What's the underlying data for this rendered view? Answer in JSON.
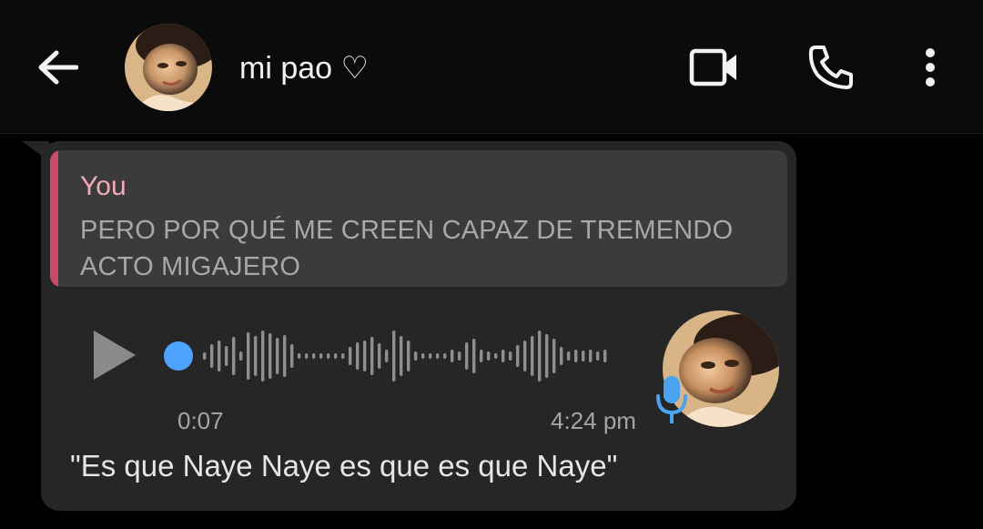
{
  "header": {
    "contact_name": "mi pao ♡",
    "back_icon": "arrow-left-icon",
    "video_icon": "video-camera-icon",
    "call_icon": "phone-icon",
    "menu_icon": "more-vertical-icon"
  },
  "message": {
    "quote": {
      "author": "You",
      "text": "PERO POR QUÉ ME CREEN CAPAZ DE TREMENDO ACTO MIGAJERO"
    },
    "voice_note": {
      "duration": "0:07",
      "sent_time": "4:24 pm",
      "progress": 0,
      "transcript": "\"Es que Naye Naye es que es que Naye\""
    }
  },
  "colors": {
    "header_bg": "#0b0b0b",
    "bubble_bg": "#262626",
    "quote_bg": "#3b3b3b",
    "quote_accent": "#c94a6a",
    "quote_author": "#f4a9b8",
    "progress_dot": "#4da3ff",
    "mic": "#4aa3f0"
  }
}
